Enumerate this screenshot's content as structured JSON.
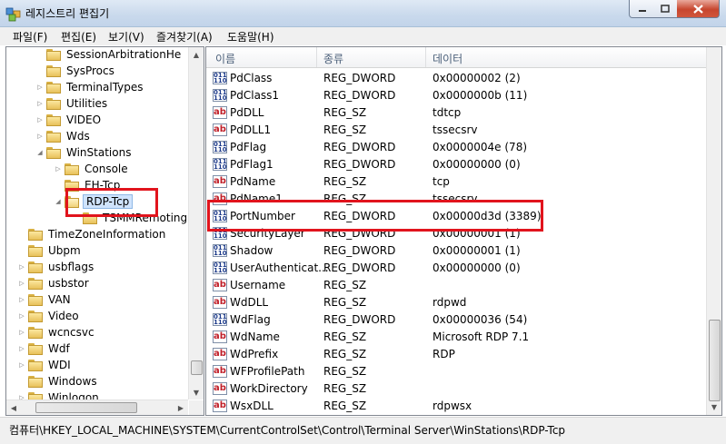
{
  "window": {
    "title": "레지스트리 편집기",
    "accent": "#c7462e"
  },
  "menu": [
    "파일(F)",
    "편집(E)",
    "보기(V)",
    "즐겨찾기(A)",
    "도움말(H)"
  ],
  "tree": {
    "items": [
      {
        "label": "SessionArbitrationHe",
        "expander": "",
        "level": 1
      },
      {
        "label": "SysProcs",
        "expander": "",
        "level": 1
      },
      {
        "label": "TerminalTypes",
        "expander": "▷",
        "level": 1
      },
      {
        "label": "Utilities",
        "expander": "▷",
        "level": 1
      },
      {
        "label": "VIDEO",
        "expander": "▷",
        "level": 1
      },
      {
        "label": "Wds",
        "expander": "▷",
        "level": 1
      },
      {
        "label": "WinStations",
        "expander": "◢",
        "level": 1
      },
      {
        "label": "Console",
        "expander": "▷",
        "level": 2
      },
      {
        "label": "EH-Tcp",
        "expander": "",
        "level": 2
      },
      {
        "label": "RDP-Tcp",
        "expander": "◢",
        "level": 2,
        "selected": true
      },
      {
        "label": "TSMMRemoting",
        "expander": "",
        "level": 3
      },
      {
        "label": "TimeZoneInformation",
        "expander": "",
        "level": 0
      },
      {
        "label": "Ubpm",
        "expander": "",
        "level": 0
      },
      {
        "label": "usbflags",
        "expander": "▷",
        "level": 0
      },
      {
        "label": "usbstor",
        "expander": "▷",
        "level": 0
      },
      {
        "label": "VAN",
        "expander": "▷",
        "level": 0
      },
      {
        "label": "Video",
        "expander": "▷",
        "level": 0
      },
      {
        "label": "wcncsvc",
        "expander": "▷",
        "level": 0
      },
      {
        "label": "Wdf",
        "expander": "▷",
        "level": 0
      },
      {
        "label": "WDI",
        "expander": "▷",
        "level": 0
      },
      {
        "label": "Windows",
        "expander": "",
        "level": 0
      },
      {
        "label": "Winlogon",
        "expander": "▷",
        "level": 0
      }
    ]
  },
  "list": {
    "columns": [
      "이름",
      "종류",
      "데이터"
    ],
    "rows": [
      {
        "name": "PdClass",
        "type": "REG_DWORD",
        "data": "0x00000002 (2)",
        "icon": "binary"
      },
      {
        "name": "PdClass1",
        "type": "REG_DWORD",
        "data": "0x0000000b (11)",
        "icon": "binary"
      },
      {
        "name": "PdDLL",
        "type": "REG_SZ",
        "data": "tdtcp",
        "icon": "string"
      },
      {
        "name": "PdDLL1",
        "type": "REG_SZ",
        "data": "tssecsrv",
        "icon": "string"
      },
      {
        "name": "PdFlag",
        "type": "REG_DWORD",
        "data": "0x0000004e (78)",
        "icon": "binary"
      },
      {
        "name": "PdFlag1",
        "type": "REG_DWORD",
        "data": "0x00000000 (0)",
        "icon": "binary"
      },
      {
        "name": "PdName",
        "type": "REG_SZ",
        "data": "tcp",
        "icon": "string"
      },
      {
        "name": "PdName1",
        "type": "REG_SZ",
        "data": "tssecsrv",
        "icon": "string"
      },
      {
        "name": "PortNumber",
        "type": "REG_DWORD",
        "data": "0x00000d3d (3389)",
        "icon": "binary",
        "highlighted": true
      },
      {
        "name": "SecurityLayer",
        "type": "REG_DWORD",
        "data": "0x00000001 (1)",
        "icon": "binary"
      },
      {
        "name": "Shadow",
        "type": "REG_DWORD",
        "data": "0x00000001 (1)",
        "icon": "binary"
      },
      {
        "name": "UserAuthenticat...",
        "type": "REG_DWORD",
        "data": "0x00000000 (0)",
        "icon": "binary"
      },
      {
        "name": "Username",
        "type": "REG_SZ",
        "data": "",
        "icon": "string"
      },
      {
        "name": "WdDLL",
        "type": "REG_SZ",
        "data": "rdpwd",
        "icon": "string"
      },
      {
        "name": "WdFlag",
        "type": "REG_DWORD",
        "data": "0x00000036 (54)",
        "icon": "binary"
      },
      {
        "name": "WdName",
        "type": "REG_SZ",
        "data": "Microsoft RDP 7.1",
        "icon": "string"
      },
      {
        "name": "WdPrefix",
        "type": "REG_SZ",
        "data": "RDP",
        "icon": "string"
      },
      {
        "name": "WFProfilePath",
        "type": "REG_SZ",
        "data": "",
        "icon": "string"
      },
      {
        "name": "WorkDirectory",
        "type": "REG_SZ",
        "data": "",
        "icon": "string"
      },
      {
        "name": "WsxDLL",
        "type": "REG_SZ",
        "data": "rdpwsx",
        "icon": "string"
      }
    ]
  },
  "statusbar": {
    "path": "컴퓨터\\HKEY_LOCAL_MACHINE\\SYSTEM\\CurrentControlSet\\Control\\Terminal Server\\WinStations\\RDP-Tcp"
  },
  "highlight_color": "#e1141d"
}
